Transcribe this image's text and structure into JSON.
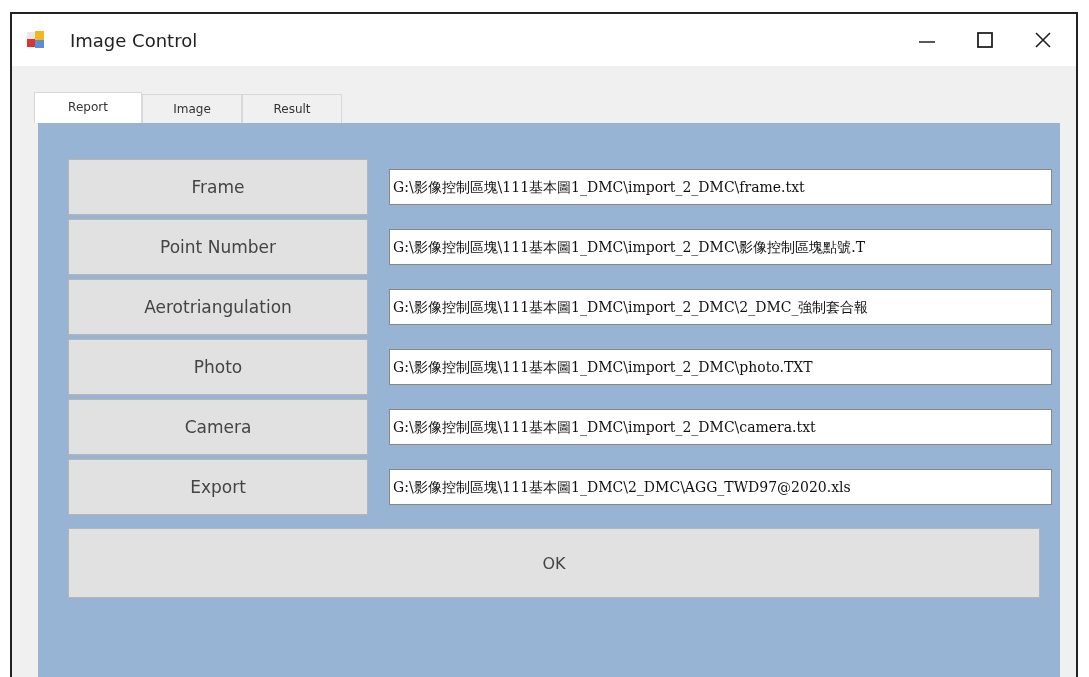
{
  "window": {
    "title": "Image Control"
  },
  "tabs": [
    {
      "label": "Report",
      "selected": true
    },
    {
      "label": "Image",
      "selected": false
    },
    {
      "label": "Result",
      "selected": false
    }
  ],
  "rows": [
    {
      "button": "Frame",
      "path": "G:\\影像控制區塊\\111基本圖1_DMC\\import_2_DMC\\frame.txt"
    },
    {
      "button": "Point Number",
      "path": "G:\\影像控制區塊\\111基本圖1_DMC\\import_2_DMC\\影像控制區塊點號.T"
    },
    {
      "button": "Aerotriangulation",
      "path": "G:\\影像控制區塊\\111基本圖1_DMC\\import_2_DMC\\2_DMC_強制套合報"
    },
    {
      "button": "Photo",
      "path": "G:\\影像控制區塊\\111基本圖1_DMC\\import_2_DMC\\photo.TXT"
    },
    {
      "button": "Camera",
      "path": "G:\\影像控制區塊\\111基本圖1_DMC\\import_2_DMC\\camera.txt"
    },
    {
      "button": "Export",
      "path": "G:\\影像控制區塊\\111基本圖1_DMC\\2_DMC\\AGG_TWD97@2020.xls"
    }
  ],
  "ok_button": "OK"
}
